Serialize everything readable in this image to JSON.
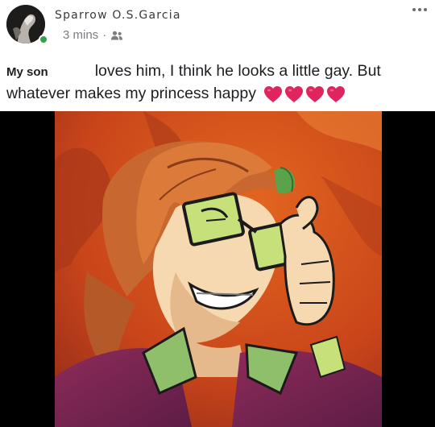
{
  "post": {
    "author": "Sparrow O.S.Garcia",
    "time": "3 mins",
    "separator": "·",
    "audience_icon": "friends-icon",
    "more_icon": "more-options-icon",
    "text": {
      "line1_start": "My son",
      "line1_end": "loves him, I think he looks a little gay. But",
      "line2": "whatever makes my princess happy"
    },
    "emoji": [
      "heart-icon",
      "heart-icon",
      "heart-icon",
      "heart-icon"
    ],
    "colors": {
      "heart": "#e0245e",
      "online": "#31a24c",
      "meta_gray": "#7a7d82"
    }
  },
  "image": {
    "icon": "cartoon-character-with-green-glasses"
  }
}
